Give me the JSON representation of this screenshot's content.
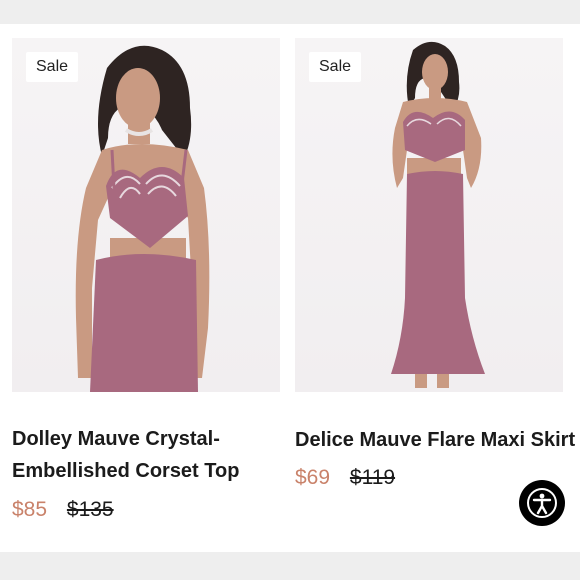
{
  "products": [
    {
      "badge": "Sale",
      "title": "Dolley Mauve Crystal-Embellished Corset Top",
      "sale_price": "$85",
      "original_price": "$135"
    },
    {
      "badge": "Sale",
      "title": "Delice Mauve Flare Maxi Skirt",
      "sale_price": "$69",
      "original_price": "$119"
    }
  ],
  "accessibility": {
    "icon": "accessibility-icon"
  },
  "colors": {
    "sale_price": "#c9826a",
    "mauve": "#a8697f",
    "accessibility_button": "#000000"
  }
}
